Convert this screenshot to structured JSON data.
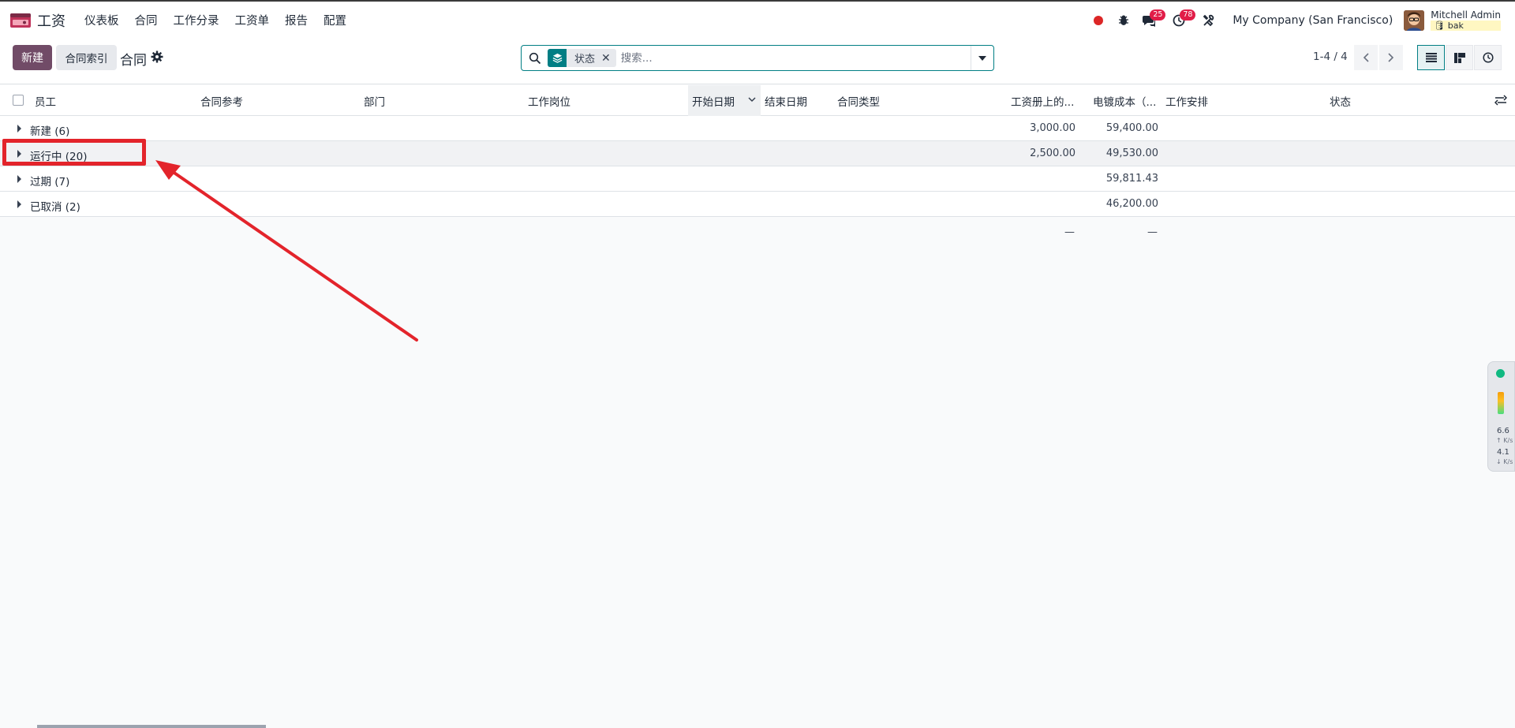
{
  "app": {
    "name": "工资",
    "menu": [
      "仪表板",
      "合同",
      "工作分录",
      "工资单",
      "报告",
      "配置"
    ]
  },
  "systray": {
    "messages_count": "25",
    "activities_count": "78",
    "company": "My Company (San Francisco)",
    "user_name": "Mitchell Admin",
    "db_name": "bak"
  },
  "control": {
    "new_label": "新建",
    "index_label": "合同索引",
    "breadcrumb": "合同",
    "facet_label": "状态",
    "search_placeholder": "搜索...",
    "pager": "1-4 / 4"
  },
  "table": {
    "columns": [
      "员工",
      "合同参考",
      "部门",
      "工作岗位",
      "开始日期",
      "结束日期",
      "合同类型",
      "工资册上的...",
      "电镀成本（...",
      "工作安排",
      "状态"
    ],
    "groups": [
      {
        "label": "新建 (6)",
        "wage": "3,000.00",
        "cost": "59,400.00"
      },
      {
        "label": "运行中 (20)",
        "wage": "2,500.00",
        "cost": "49,530.00"
      },
      {
        "label": "过期 (7)",
        "wage": "",
        "cost": "59,811.43"
      },
      {
        "label": "已取消 (2)",
        "wage": "",
        "cost": "46,200.00"
      }
    ],
    "footer": {
      "wage": "—",
      "cost": "—"
    }
  },
  "widget": {
    "up_value": "6.6",
    "up_unit": "K/s",
    "down_value": "4.1",
    "down_unit": "K/s"
  },
  "colors": {
    "primary": "#714b67",
    "accent": "#017e84",
    "annotation": "#e3242b",
    "badge": "#e11d48"
  }
}
